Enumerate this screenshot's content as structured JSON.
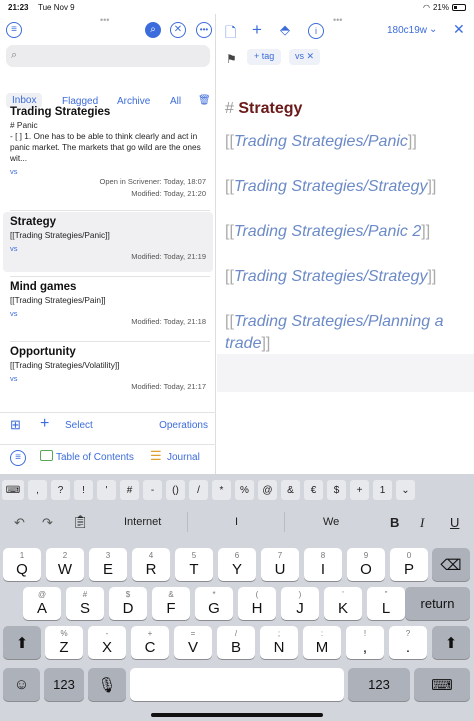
{
  "status": {
    "time": "21:23",
    "date": "Tue Nov 9",
    "battery": "21%"
  },
  "sidebar": {
    "tabs": [
      "Inbox",
      "Flagged",
      "Archive",
      "All"
    ],
    "notes": [
      {
        "title": "Trading Strategies",
        "body": "# Panic\n- [ ] 1.  One has to be able to think clearly and act in panic market. The markets that go wild are the ones wit...",
        "tag": "vs",
        "meta1": "Open in Scrivener: Today, 18:07",
        "meta2": "Modified: Today, 21:20"
      },
      {
        "title": "Strategy",
        "body": "[[Trading Strategies/Panic]]",
        "tag": "vs",
        "meta2": "Modified: Today, 21:19"
      },
      {
        "title": "Mind games",
        "body": "[[Trading Strategies/Pain]]",
        "tag": "vs",
        "meta2": "Modified: Today, 21:18"
      },
      {
        "title": "Opportunity",
        "body": "[[Trading Strategies/Volatility]]",
        "tag": "vs",
        "meta2": "Modified: Today, 21:17"
      }
    ],
    "bottom": {
      "select": "Select",
      "operations": "Operations",
      "toc": "Table of Contents",
      "journal": "Journal"
    }
  },
  "editor": {
    "note_id": "180c19w",
    "tag_button": "+ tag",
    "tag_chip": "vs",
    "heading_hash": "#",
    "heading": "Strategy",
    "links": [
      "Trading Strategies/Panic",
      "Trading Strategies/Strategy",
      "Trading Strategies/Panic 2",
      "Trading Strategies/Strategy",
      "Trading Strategies/Planning a",
      "trade"
    ]
  },
  "keyboard": {
    "numrow": [
      ",",
      "?",
      "!",
      "'",
      "#",
      "-",
      "()",
      "/",
      "*",
      "%",
      "@",
      "&",
      "€",
      "$",
      "+",
      "1"
    ],
    "suggestions": [
      "Internet",
      "I",
      "We"
    ],
    "row1": [
      [
        "1",
        "Q"
      ],
      [
        "2",
        "W"
      ],
      [
        "3",
        "E"
      ],
      [
        "4",
        "R"
      ],
      [
        "5",
        "T"
      ],
      [
        "6",
        "Y"
      ],
      [
        "7",
        "U"
      ],
      [
        "8",
        "I"
      ],
      [
        "9",
        "O"
      ],
      [
        "0",
        "P"
      ]
    ],
    "row2": [
      [
        "@",
        "A"
      ],
      [
        "#",
        "S"
      ],
      [
        "$",
        "D"
      ],
      [
        "&",
        "F"
      ],
      [
        "*",
        "G"
      ],
      [
        "(",
        "H"
      ],
      [
        ")",
        "J"
      ],
      [
        "'",
        "K"
      ],
      [
        "\"",
        "L"
      ]
    ],
    "row3": [
      [
        "%",
        "Z"
      ],
      [
        "-",
        "X"
      ],
      [
        "+",
        "C"
      ],
      [
        "=",
        "V"
      ],
      [
        "/",
        "B"
      ],
      [
        ";",
        "N"
      ],
      [
        ":",
        "M"
      ],
      [
        "!",
        ","
      ],
      [
        "?",
        "."
      ]
    ],
    "return_label": "return",
    "num_label": "123"
  },
  "colors": {
    "accent": "#3c6cdc",
    "heading": "#6b1a1a",
    "link": "#6b8ac7"
  }
}
